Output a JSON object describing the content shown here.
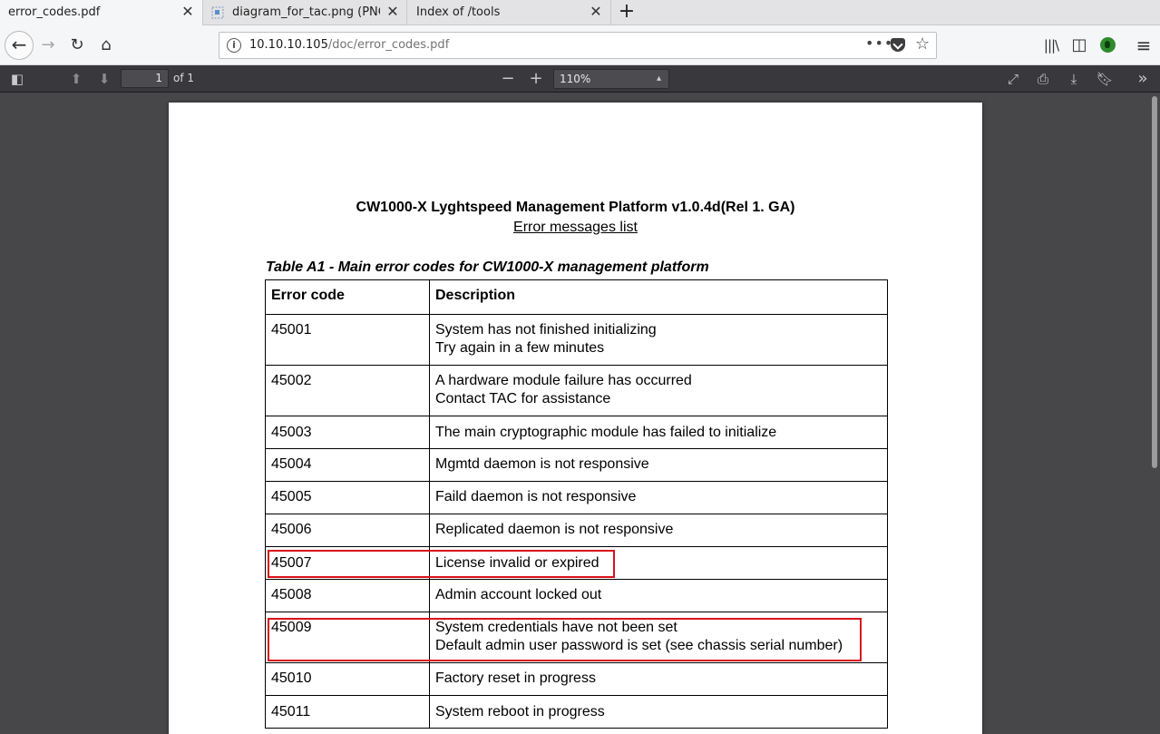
{
  "tabs": [
    {
      "title": "error_codes.pdf",
      "active": true
    },
    {
      "title": "diagram_for_tac.png (PNG Image",
      "active": false
    },
    {
      "title": "Index of /tools",
      "active": false
    }
  ],
  "urlbar": {
    "host": "10.10.10.105",
    "path": "/doc/error_codes.pdf"
  },
  "pdf_toolbar": {
    "page_number": "1",
    "page_count": "of 1",
    "zoom": "110%"
  },
  "document": {
    "title": "CW1000-X Lyghtspeed Management Platform v1.0.4d(Rel 1. GA)",
    "subtitle": "Error messages list",
    "table_caption": "Table A1 - Main error codes for CW1000-X management platform",
    "headers": {
      "code": "Error code",
      "description": "Description"
    },
    "rows": [
      {
        "code": "45001",
        "line1": "System has not finished initializing",
        "line2": "Try again in a few minutes"
      },
      {
        "code": "45002",
        "line1": "A hardware module failure has occurred",
        "line2": "Contact TAC for assistance"
      },
      {
        "code": "45003",
        "line1": "The main cryptographic module has failed to initialize"
      },
      {
        "code": "45004",
        "line1": "Mgmtd daemon is not responsive"
      },
      {
        "code": "45005",
        "line1": "Faild daemon is not responsive"
      },
      {
        "code": "45006",
        "line1": "Replicated daemon is not responsive"
      },
      {
        "code": "45007",
        "line1": "License invalid or expired"
      },
      {
        "code": "45008",
        "line1": "Admin account locked out"
      },
      {
        "code": "45009",
        "line1": "System credentials have not been set",
        "line2": "Default admin user password is set (see chassis serial number)"
      },
      {
        "code": "45010",
        "line1": "Factory reset in progress"
      },
      {
        "code": "45011",
        "line1": "System reboot in progress"
      }
    ]
  },
  "colors": {
    "highlight": "#d9121b",
    "viewer_bg": "#474749",
    "pdf_toolbar_bg": "#38383d"
  }
}
